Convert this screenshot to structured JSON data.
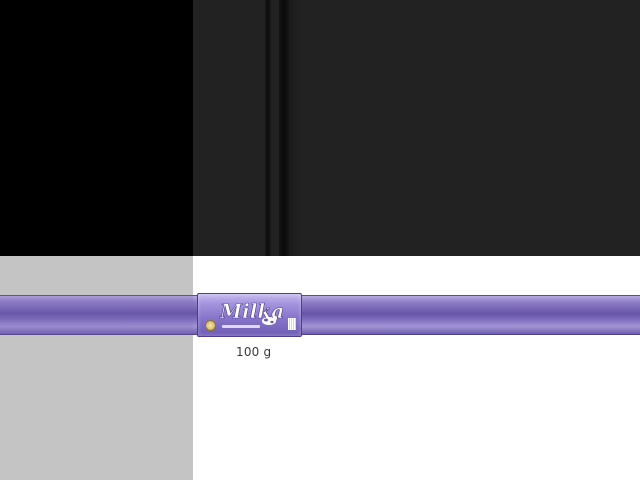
{
  "colors": {
    "top_left_panel": "#000000",
    "top_right_panel": "#222222",
    "bottom_left_panel": "#c4c4c4",
    "bottom_right_panel": "#ffffff",
    "brand_purple": "#7b6bb8"
  },
  "product": {
    "brand": "Milka",
    "weight_label": "100 g",
    "icons": [
      "brand-logo",
      "cow-icon",
      "seal-icon",
      "barcode-icon"
    ]
  }
}
